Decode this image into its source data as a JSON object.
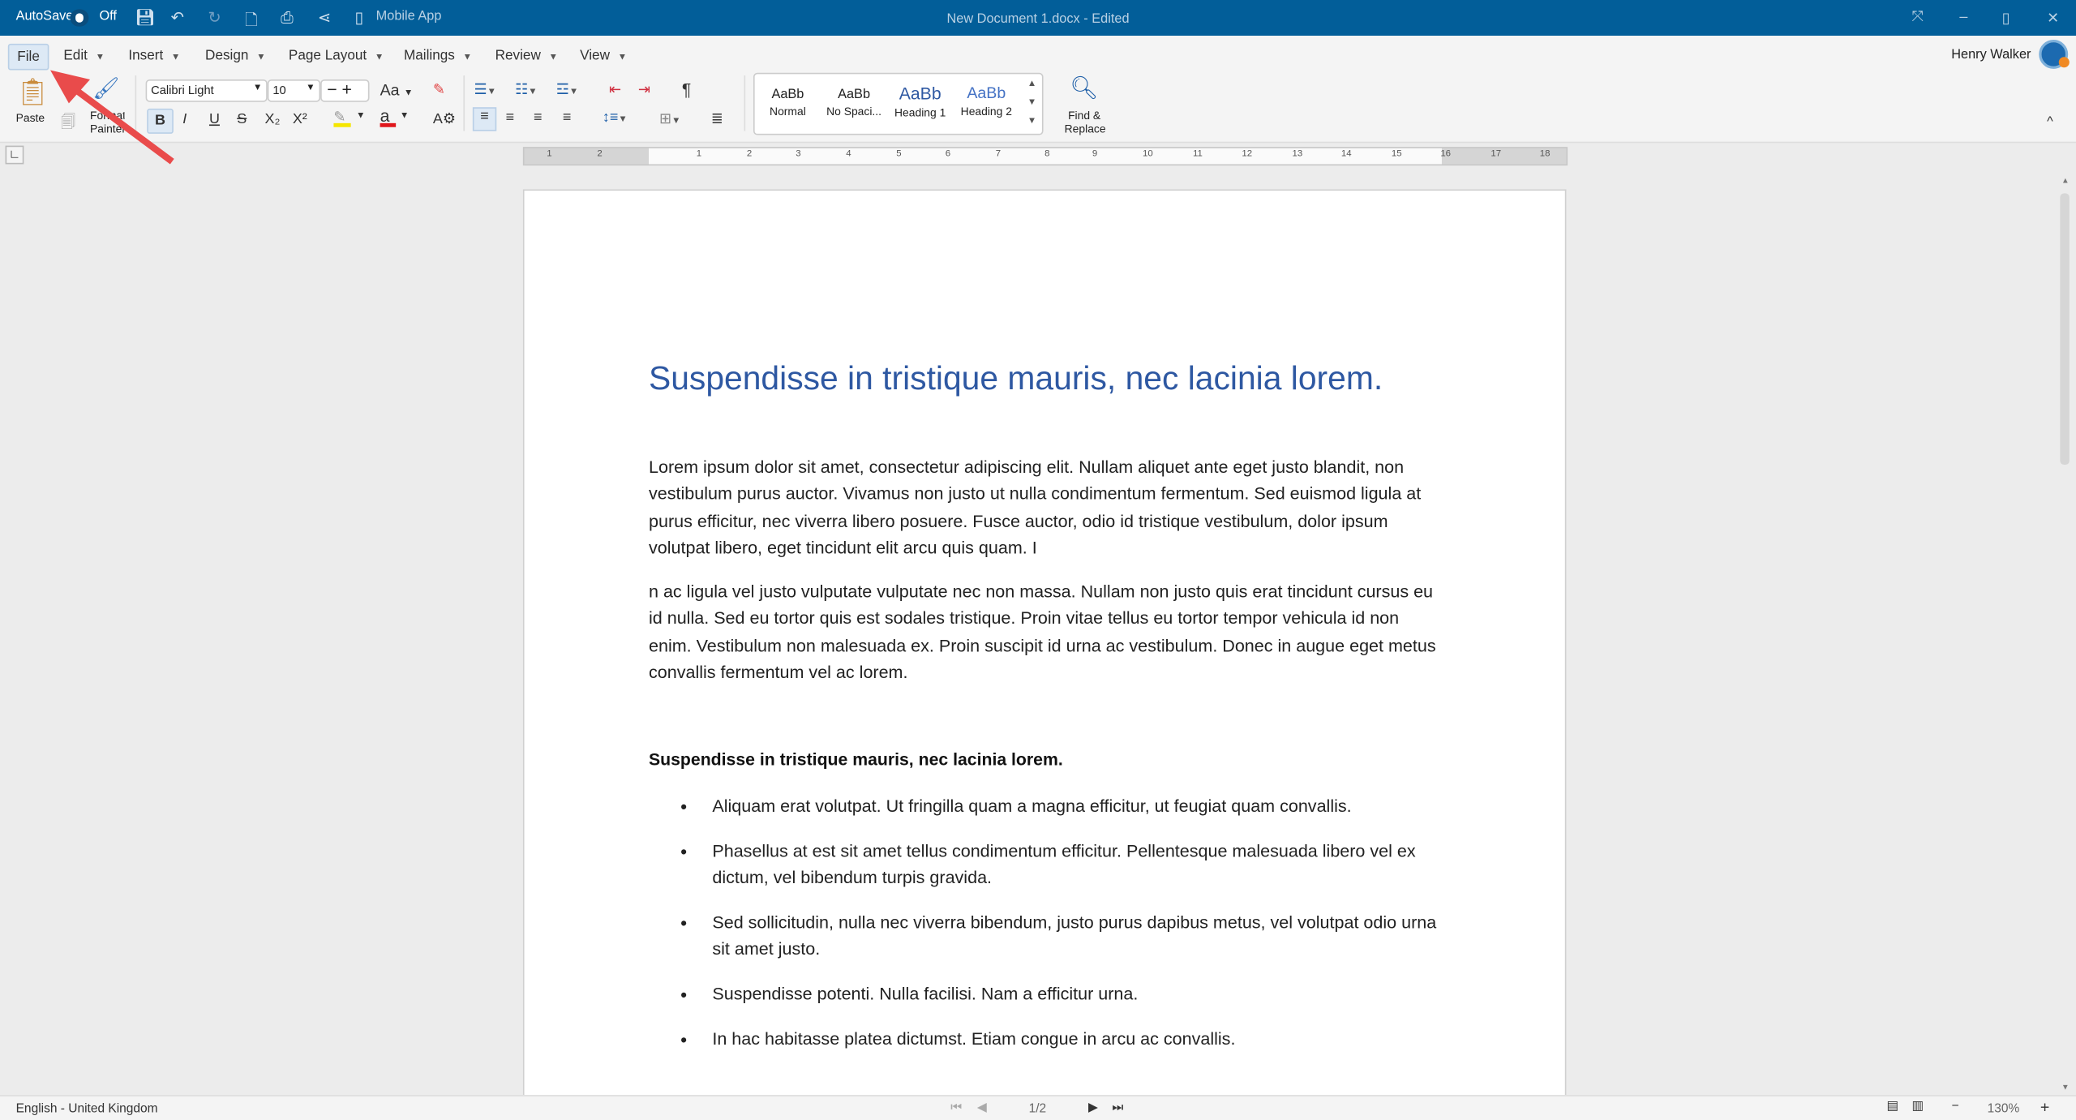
{
  "titlebar": {
    "autosave_label": "AutoSave",
    "autosave_state": "Off",
    "mobile_app": "Mobile App",
    "document_title": "New Document 1.docx - Edited"
  },
  "menu": [
    "File",
    "Edit",
    "Insert",
    "Design",
    "Page Layout",
    "Mailings",
    "Review",
    "View"
  ],
  "user": {
    "name": "Henry Walker"
  },
  "ribbon": {
    "paste": "Paste",
    "format_painter": "Format Painter",
    "font": "Calibri Light",
    "size": "10",
    "change_case": "Aa",
    "bold": "B",
    "italic": "I",
    "underline": "U",
    "strike": "S",
    "subscript": "X₂",
    "superscript": "X²",
    "highlight_color": "#f5e600",
    "font_color": "#e0161b",
    "pilcrow": "¶",
    "styles": [
      {
        "sample": "AaBb",
        "name": "Normal"
      },
      {
        "sample": "AaBb",
        "name": "No Spaci..."
      },
      {
        "sample": "AaBb",
        "name": "Heading 1"
      },
      {
        "sample": "AaBb",
        "name": "Heading 2"
      }
    ],
    "find_replace": "Find & Replace"
  },
  "ruler": [
    "1",
    "2",
    "1",
    "2",
    "3",
    "4",
    "5",
    "6",
    "7",
    "8",
    "9",
    "10",
    "11",
    "12",
    "13",
    "14",
    "15",
    "16",
    "17",
    "18"
  ],
  "document": {
    "title": "Suspendisse in tristique mauris, nec lacinia lorem.",
    "paragraphs": [
      "Lorem ipsum dolor sit amet, consectetur adipiscing elit. Nullam aliquet ante eget justo blandit, non vestibulum purus auctor. Vivamus non justo ut nulla condimentum fermentum. Sed euismod ligula at purus efficitur, nec viverra libero posuere. Fusce auctor, odio id tristique vestibulum, dolor ipsum volutpat libero, eget tincidunt elit arcu quis quam. I",
      "n ac ligula vel justo vulputate vulputate nec non massa. Nullam non justo quis erat tincidunt cursus eu id nulla. Sed eu tortor quis est sodales tristique. Proin vitae tellus eu tortor tempor vehicula id non enim. Vestibulum non malesuada ex. Proin suscipit id urna ac vestibulum. Donec in augue eget metus convallis fermentum vel ac lorem."
    ],
    "subheading": "Suspendisse in tristique mauris, nec lacinia lorem.",
    "bullets": [
      "Aliquam erat volutpat. Ut fringilla quam a magna efficitur, ut feugiat quam convallis.",
      "Phasellus at est sit amet tellus condimentum efficitur. Pellentesque malesuada libero vel ex dictum, vel bibendum turpis gravida.",
      "Sed sollicitudin, nulla nec viverra bibendum, justo purus dapibus metus, vel volutpat odio urna sit amet justo.",
      "Suspendisse potenti. Nulla facilisi. Nam a efficitur urna.",
      "In hac habitasse platea dictumst. Etiam congue in arcu ac convallis."
    ]
  },
  "status": {
    "language": "English - United Kingdom",
    "page": "1/2",
    "zoom": "130%"
  }
}
